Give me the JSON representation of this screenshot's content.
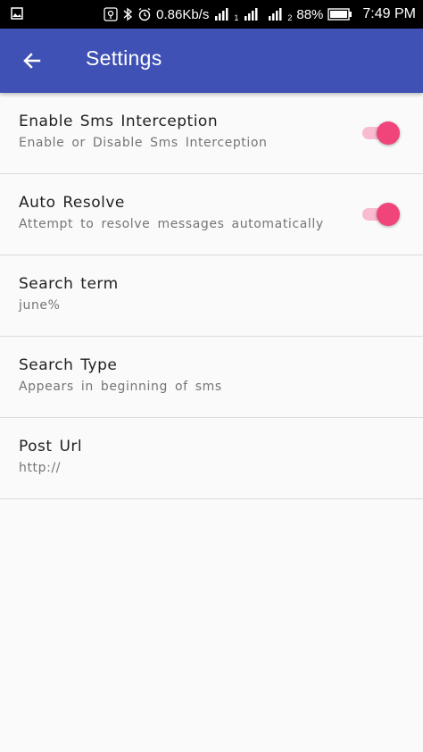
{
  "status_bar": {
    "network_speed": "0.86Kb/s",
    "sim1_label": "1",
    "sim2_label": "2",
    "battery_percent": "88%",
    "time": "7:49 PM",
    "icons": [
      "image-icon",
      "location-icon",
      "bluetooth-icon",
      "alarm-icon",
      "signal-icon",
      "battery-icon"
    ]
  },
  "app_bar": {
    "title": "Settings",
    "color": "#3f51b5"
  },
  "accent_color": "#f0457a",
  "preferences": [
    {
      "title": "Enable Sms Interception",
      "summary": "Enable or Disable Sms Interception",
      "switch_on": true
    },
    {
      "title": "Auto Resolve",
      "summary": "Attempt to resolve messages automatically",
      "switch_on": true
    },
    {
      "title": "Search term",
      "summary": "june%"
    },
    {
      "title": "Search Type",
      "summary": "Appears in beginning of sms"
    },
    {
      "title": "Post Url",
      "summary": "http://"
    }
  ]
}
